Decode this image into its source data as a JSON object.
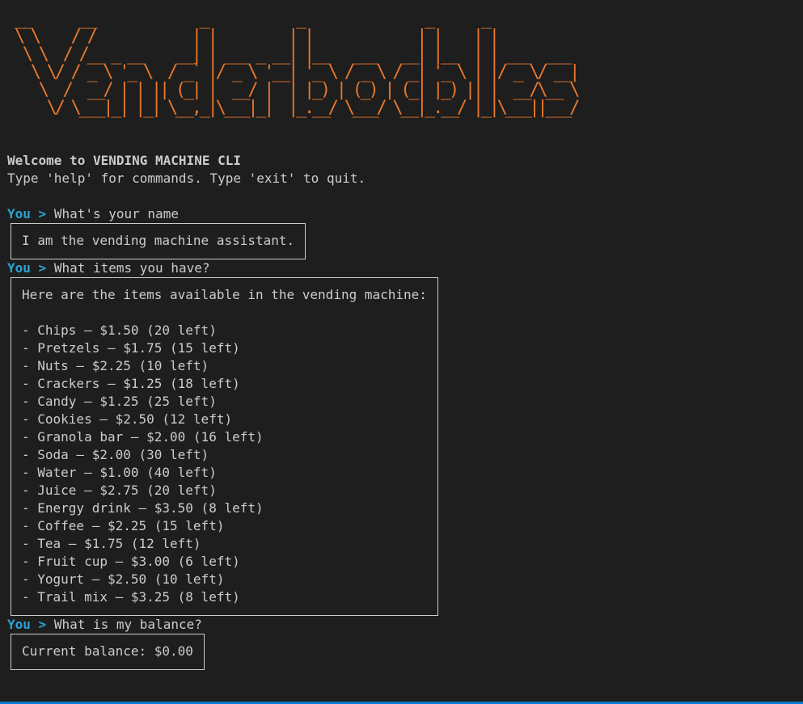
{
  "banner_lines": [
    " __      __             _           _               _      _",
    " \\ \\    / /            | |         | |             | |    | |",
    "  \\ \\  / /__ _ __    __| | ___ _ __| |__   ___   __| |__  | | ___  ___",
    "   \\ \\/ / _ \\ '_ \\  / _` |/ _ \\ '__| '_ \\ / _ \\ / _| '_ \\ | |/ _ \\/ __|",
    "    \\  /  __/ | | || (_| |  __/ |  | |_) | (_) | (_| |_) || |  __/\\__ \\",
    "     \\/ \\___|_| |_| \\__,_|\\___|_|  |_.__/ \\___/ \\__|_.__/ |_|\\___||___/"
  ],
  "intro": {
    "welcome": "Welcome to VENDING MACHINE CLI",
    "hint": "Type 'help' for commands. Type 'exit' to quit."
  },
  "prompt": {
    "user_label": "You",
    "separator": ">"
  },
  "conversation": [
    {
      "user": "What's your name",
      "response": [
        "I am the vending machine assistant."
      ]
    },
    {
      "user": "What items you have?",
      "response": [
        "Here are the items available in the vending machine:",
        "",
        "- Chips – $1.50 (20 left)",
        "- Pretzels – $1.75 (15 left)",
        "- Nuts – $2.25 (10 left)",
        "- Crackers – $1.25 (18 left)",
        "- Candy – $1.25 (25 left)",
        "- Cookies – $2.50 (12 left)",
        "- Granola bar – $2.00 (16 left)",
        "- Soda – $2.00 (30 left)",
        "- Water – $1.00 (40 left)",
        "- Juice – $2.75 (20 left)",
        "- Energy drink – $3.50 (8 left)",
        "- Coffee – $2.25 (15 left)",
        "- Tea – $1.75 (12 left)",
        "- Fruit cup – $3.00 (6 left)",
        "- Yogurt – $2.50 (10 left)",
        "- Trail mix – $3.25 (8 left)"
      ]
    },
    {
      "user": "What is my balance?",
      "response": [
        "Current balance: $0.00"
      ]
    }
  ],
  "colors": {
    "background": "#1e1e1e",
    "text": "#cccccc",
    "banner": "#e8782c",
    "prompt": "#29a3d6",
    "statusbar": "#007acc"
  }
}
